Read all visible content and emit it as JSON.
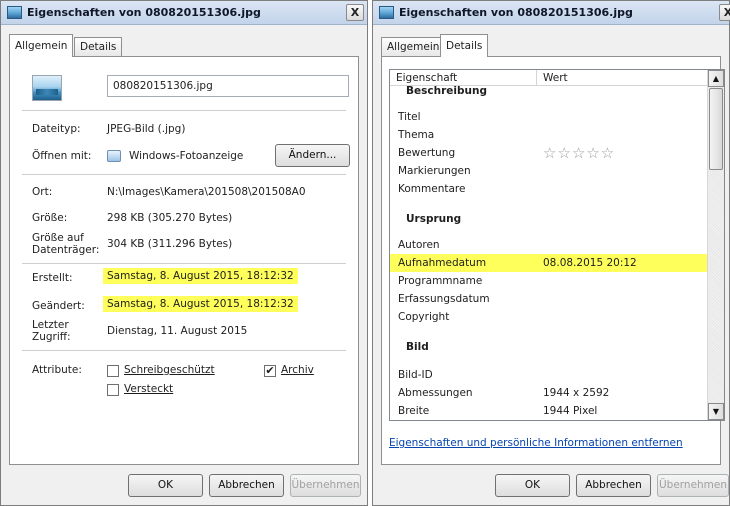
{
  "left_window": {
    "title": "Eigenschaften von 080820151306.jpg",
    "close_glyph": "X",
    "tabs": [
      "Allgemein",
      "Details"
    ],
    "filename": "080820151306.jpg",
    "fields": {
      "dateityp_label": "Dateityp:",
      "dateityp_value": "JPEG-Bild (.jpg)",
      "oeffnen_label": "Öffnen mit:",
      "oeffnen_value": "Windows-Fotoanzeige",
      "aendern_button": "Ändern...",
      "ort_label": "Ort:",
      "ort_value": "N:\\Images\\Kamera\\201508\\201508A0",
      "groesse_label": "Größe:",
      "groesse_value": "298 KB (305.270 Bytes)",
      "groesse_dt_label_1": "Größe auf",
      "groesse_dt_label_2": "Datenträger:",
      "groesse_dt_value": "304 KB (311.296 Bytes)",
      "erstellt_label": "Erstellt:",
      "erstellt_value": "Samstag, 8. August 2015, 18:12:32",
      "geaendert_label": "Geändert:",
      "geaendert_value": "Samstag, 8. August 2015, 18:12:32",
      "zugriff_label_1": "Letzter",
      "zugriff_label_2": "Zugriff:",
      "zugriff_value": "Dienstag, 11. August 2015",
      "attribute_label": "Attribute:"
    },
    "attributes": {
      "schreibgeschuetzt": {
        "label": "Schreibgeschützt",
        "checked": false
      },
      "versteckt": {
        "label": "Versteckt",
        "checked": false
      },
      "archiv": {
        "label": "Archiv",
        "checked": true
      },
      "check_glyph": "✔"
    },
    "buttons": {
      "ok": "OK",
      "cancel": "Abbrechen",
      "apply": "Übernehmen"
    }
  },
  "right_window": {
    "title": "Eigenschaften von 080820151306.jpg",
    "close_glyph": "X",
    "tabs": [
      "Allgemein",
      "Details"
    ],
    "columns": [
      "Eigenschaft",
      "Wert"
    ],
    "groups": {
      "beschreibung": "Beschreibung",
      "ursprung": "Ursprung",
      "bild": "Bild"
    },
    "rows": {
      "titel": {
        "k": "Titel",
        "v": ""
      },
      "thema": {
        "k": "Thema",
        "v": ""
      },
      "bewertung": {
        "k": "Bewertung",
        "stars": "☆☆☆☆☆",
        "rating": 0
      },
      "markierungen": {
        "k": "Markierungen",
        "v": ""
      },
      "kommentare": {
        "k": "Kommentare",
        "v": ""
      },
      "autoren": {
        "k": "Autoren",
        "v": ""
      },
      "aufnahmedatum": {
        "k": "Aufnahmedatum",
        "v": "08.08.2015 20:12"
      },
      "programmname": {
        "k": "Programmname",
        "v": ""
      },
      "erfassungsdatum": {
        "k": "Erfassungsdatum",
        "v": ""
      },
      "copyright": {
        "k": "Copyright",
        "v": ""
      },
      "bild_id": {
        "k": "Bild-ID",
        "v": ""
      },
      "abmessungen": {
        "k": "Abmessungen",
        "v": "1944 x 2592"
      },
      "breite": {
        "k": "Breite",
        "v": "1944 Pixel"
      }
    },
    "scroll": {
      "up_glyph": "▲",
      "down_glyph": "▼"
    },
    "remove_link": "Eigenschaften und persönliche Informationen entfernen",
    "buttons": {
      "ok": "OK",
      "cancel": "Abbrechen",
      "apply": "Übernehmen"
    }
  },
  "colors": {
    "highlight": "#ffff5c",
    "link": "#0645ad",
    "titlebar": "#c2d3ea"
  }
}
